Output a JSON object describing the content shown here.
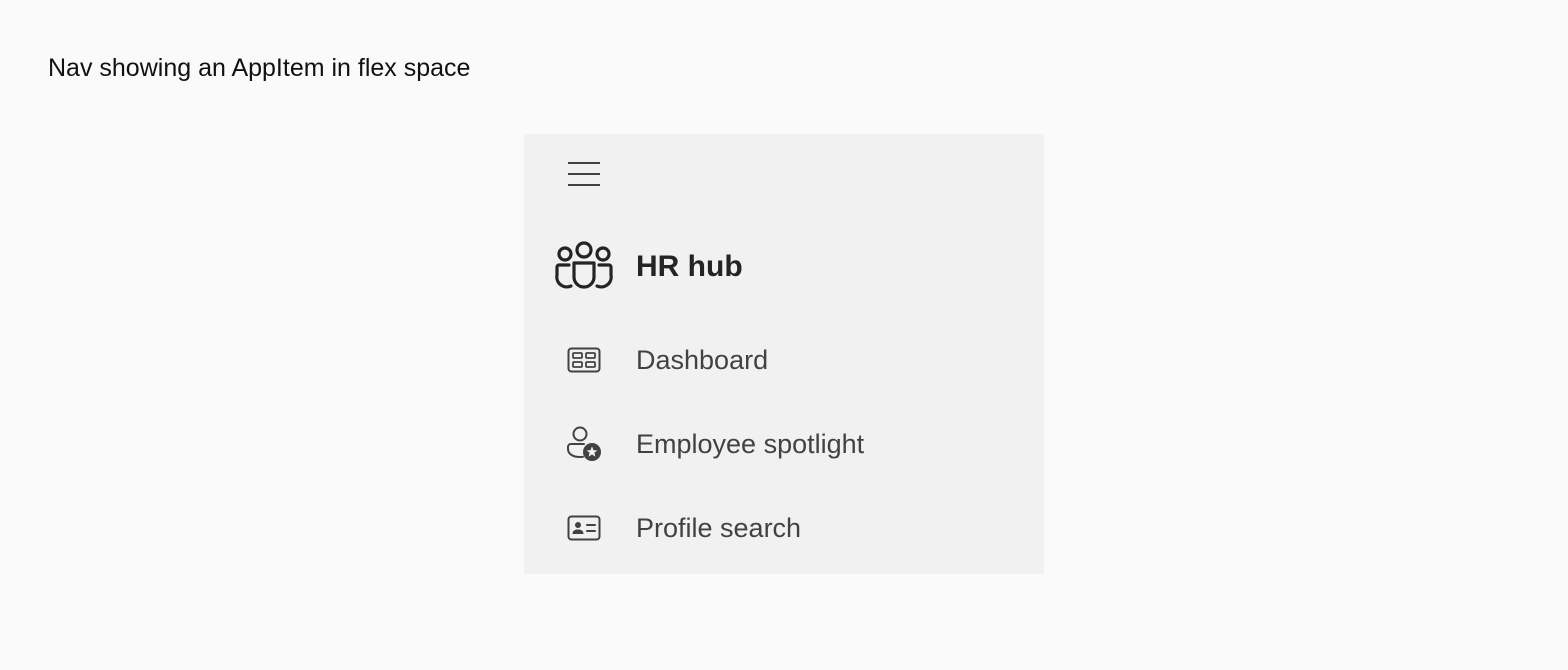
{
  "caption": "Nav showing an AppItem in flex space",
  "nav": {
    "hamburger_icon": "hamburger-menu-icon",
    "app_item": {
      "label": "HR hub",
      "icon": "people-community-icon"
    },
    "items": [
      {
        "label": "Dashboard",
        "icon": "board-icon"
      },
      {
        "label": "Employee spotlight",
        "icon": "person-star-icon"
      },
      {
        "label": "Profile search",
        "icon": "contact-card-icon"
      }
    ]
  },
  "colors": {
    "page_background": "#fafafa",
    "nav_background": "#f1f1f1",
    "app_item_text": "#242424",
    "item_text": "#424242"
  }
}
